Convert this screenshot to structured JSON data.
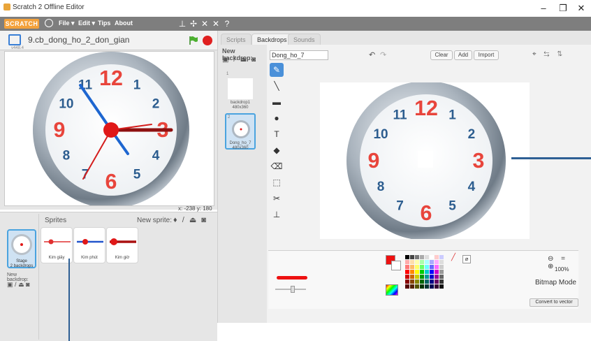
{
  "window": {
    "title": "Scratch 2 Offline Editor",
    "controls": [
      "–",
      "❐",
      "✕"
    ]
  },
  "menubar": {
    "logo": "SCRATCH",
    "menus": [
      "File ▾",
      "Edit ▾",
      "Tips",
      "About"
    ],
    "toolbar_icons": [
      "duplicate-icon",
      "cut-icon",
      "grow-icon",
      "shrink-icon",
      "help-icon"
    ],
    "toolbar_glyphs": [
      "⊥",
      "✢",
      "✕",
      "✕",
      "?"
    ]
  },
  "stage": {
    "project_title": "9.cb_dong_ho_2_don_gian",
    "version": "v448.4",
    "coords": {
      "x_label": "x:",
      "x": "-238",
      "y_label": "y:",
      "y": "180"
    }
  },
  "clock": {
    "numbers": [
      "12",
      "1",
      "2",
      "3",
      "4",
      "5",
      "6",
      "7",
      "8",
      "9",
      "10",
      "11"
    ],
    "red_numbers": [
      "12",
      "3",
      "6",
      "9"
    ],
    "blue_color": "#2c5d8f",
    "red_color": "#e8453c",
    "hands": {
      "second_deg": 90,
      "minute_deg": -40,
      "hour_deg": 210
    }
  },
  "sprites_pane": {
    "title": "Sprites",
    "new_sprite_label": "New sprite:",
    "stage_tile": {
      "name": "Stage",
      "info": "2 backdrops"
    },
    "new_backdrop_label": "New backdrop:",
    "sprites": [
      {
        "name": "Kim giây",
        "color": "#e03030"
      },
      {
        "name": "Kim phút",
        "color": "#2255cc"
      },
      {
        "name": "Kim giờ",
        "color": "#aa1111"
      }
    ]
  },
  "editor": {
    "tabs": [
      "Scripts",
      "Backdrops",
      "Sounds"
    ],
    "active_tab": "Backdrops",
    "new_backdrop_label": "New backdrop:",
    "backdrops": [
      {
        "num": "1",
        "name": "backdrop1",
        "size": "480x360"
      },
      {
        "num": "2",
        "name": "Dong_ho_7",
        "size": "480x360"
      }
    ],
    "costume_name": "Dong_ho_7",
    "buttons": {
      "clear": "Clear",
      "add": "Add",
      "import": "Import"
    },
    "tools": [
      "brush-icon",
      "line-icon",
      "rectangle-icon",
      "ellipse-icon",
      "text-icon",
      "fill-icon",
      "eraser-icon",
      "select-icon",
      "stamp-select-icon",
      "stamp-icon"
    ],
    "tool_glyphs": [
      "✎",
      "╲",
      "▬",
      "●",
      "T",
      "◆",
      "⌫",
      "⬚",
      "✂",
      "⊥"
    ],
    "zoom": "100%",
    "mode": "Bitmap Mode",
    "convert_label": "Convert to vector",
    "primary_color": "#ee1111"
  }
}
